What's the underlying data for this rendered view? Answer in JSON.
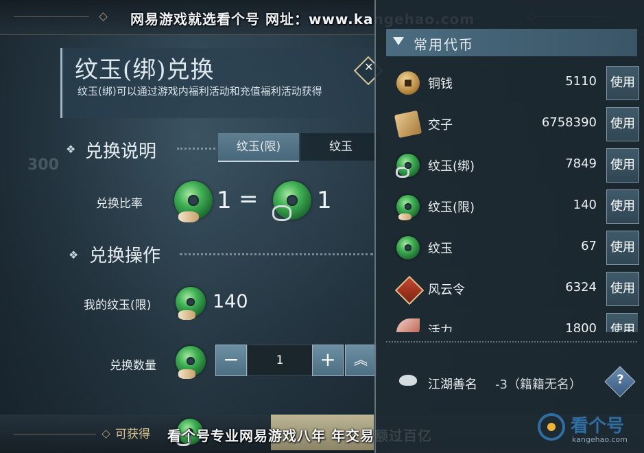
{
  "watermark": {
    "top": "网易游戏就选看个号  网址：www.kangehao.com",
    "bottom": "看个号专业网易游戏八年  年交易额过百亿",
    "logo_text": "看个号",
    "logo_sub": "kangehao.com"
  },
  "exchange": {
    "title": "纹玉(绑)兑换",
    "description": "纹玉(绑)可以通过游戏内福利活动和充值福利活动获得",
    "section_explain": "兑换说明",
    "section_operate": "兑换操作",
    "tabs": [
      {
        "label": "纹玉(限)",
        "active": true
      },
      {
        "label": "纹玉",
        "active": false
      }
    ],
    "rate_label": "兑换比率",
    "rate_left": "1",
    "rate_eq": "=",
    "rate_right": "1",
    "my_jade_label": "我的纹玉(限)",
    "my_jade_value": "140",
    "qty_label": "兑换数量",
    "qty_value": "1",
    "minus": "−",
    "plus": "+",
    "max_icon": "︽",
    "obtain_label": "可获得"
  },
  "currency": {
    "header": "常用代币",
    "use_label": "使用",
    "items": [
      {
        "name": "铜钱",
        "amount": "5110",
        "icon": "copper-coin-icon"
      },
      {
        "name": "交子",
        "amount": "6758390",
        "icon": "jiaozi-note-icon"
      },
      {
        "name": "纹玉(绑)",
        "amount": "7849",
        "icon": "jade-bound-icon"
      },
      {
        "name": "纹玉(限)",
        "amount": "140",
        "icon": "jade-limited-icon"
      },
      {
        "name": "纹玉",
        "amount": "67",
        "icon": "jade-icon"
      },
      {
        "name": "风云令",
        "amount": "6324",
        "icon": "fengyun-token-icon"
      },
      {
        "name": "活力",
        "amount": "1800",
        "icon": "vitality-icon"
      }
    ],
    "reputation": {
      "name": "江湖善名",
      "value": "-3（籍籍无名）"
    },
    "help_icon": "?"
  },
  "colors": {
    "accent_gold": "#d8c69a",
    "tab_active": "#5f7f91",
    "jade_green": "#3fb053"
  }
}
